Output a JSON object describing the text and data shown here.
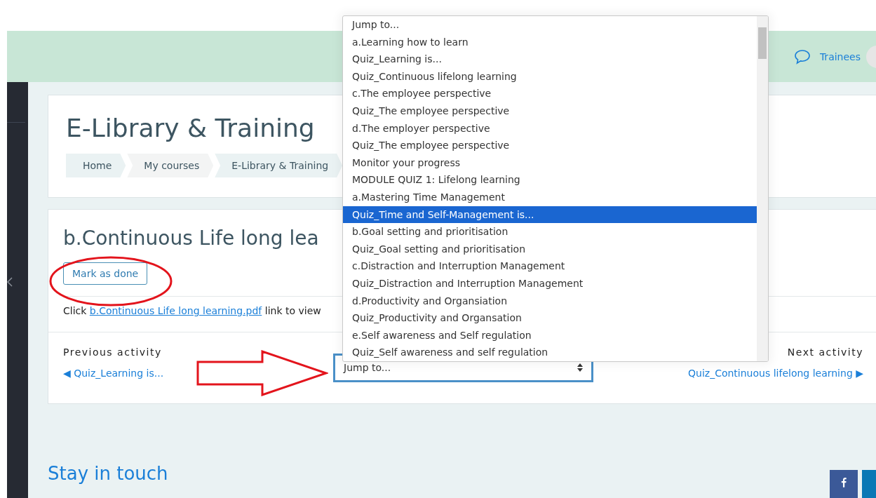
{
  "header": {
    "user_menu": "Trainees"
  },
  "course_header": {
    "title": "E-Library & Training",
    "breadcrumb": [
      "Home",
      "My courses",
      "E-Library & Training"
    ]
  },
  "activity": {
    "title": "b.Continuous Life long lea",
    "mark_button": "Mark as done",
    "intro_before": "Click",
    "intro_link": "b.Continuous Life long learning.pdf",
    "intro_after": "link to view"
  },
  "navigation": {
    "previous_label": "Previous activity",
    "previous_link": "◀ Quiz_Learning is...",
    "jump_select": {
      "value": "Jump to..."
    },
    "next_label": "Next activity",
    "next_link": "Quiz_Continuous lifelong learning ▶"
  },
  "jump_menu": {
    "options": [
      {
        "label": "Jump to...",
        "selected": false
      },
      {
        "label": "a.Learning how to learn",
        "selected": false
      },
      {
        "label": "Quiz_Learning is...",
        "selected": false
      },
      {
        "label": "Quiz_Continuous lifelong learning",
        "selected": false
      },
      {
        "label": "c.The employee perspective",
        "selected": false
      },
      {
        "label": "Quiz_The employee perspective",
        "selected": false
      },
      {
        "label": "d.The employer perspective",
        "selected": false
      },
      {
        "label": "Quiz_The employee perspective",
        "selected": false
      },
      {
        "label": "Monitor your progress",
        "selected": false
      },
      {
        "label": "MODULE QUIZ 1: Lifelong learning",
        "selected": false
      },
      {
        "label": "a.Mastering Time Management",
        "selected": false
      },
      {
        "label": "Quiz_Time and Self-Management is...",
        "selected": true
      },
      {
        "label": "b.Goal setting and prioritisation",
        "selected": false
      },
      {
        "label": "Quiz_Goal setting and prioritisation",
        "selected": false
      },
      {
        "label": "c.Distraction and Interruption Management",
        "selected": false
      },
      {
        "label": "Quiz_Distraction and Interruption Management",
        "selected": false
      },
      {
        "label": "d.Productivity and Organsiation",
        "selected": false
      },
      {
        "label": "Quiz_Productivity and Organsation",
        "selected": false
      },
      {
        "label": "e.Self awareness and Self regulation",
        "selected": false
      },
      {
        "label": "Quiz_Self awareness and self regulation",
        "selected": false
      }
    ]
  },
  "footer": {
    "heading": "Stay in touch"
  }
}
